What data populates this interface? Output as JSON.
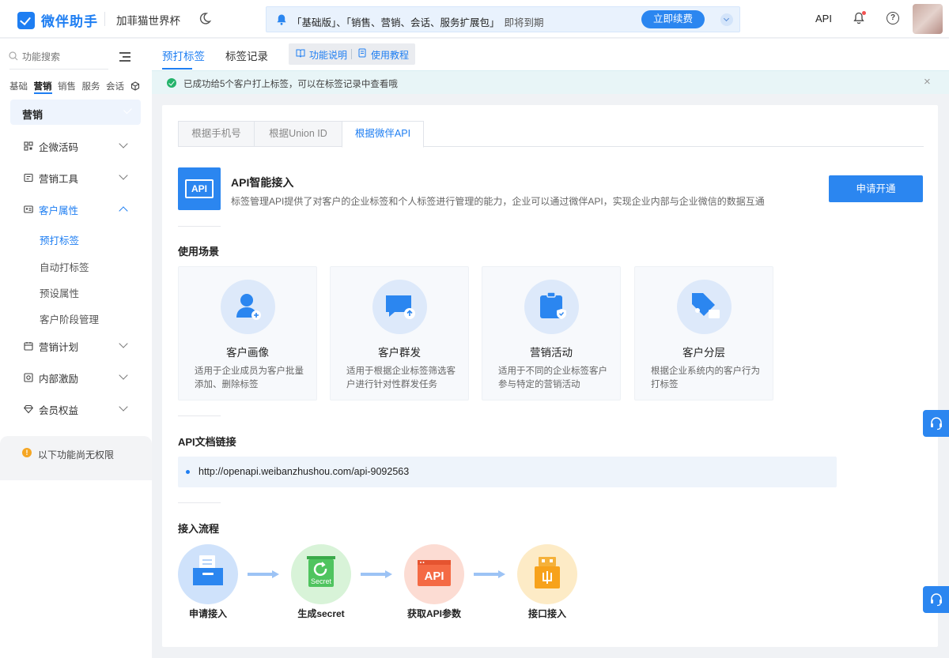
{
  "header": {
    "logo_text": "微伴助手",
    "corp_name": "加菲猫世界杯",
    "notice_text": "「基础版」、「销售、营销、会话、服务扩展包」",
    "notice_suffix": "即将到期",
    "renew_label": "立即续费",
    "api_label": "API",
    "help_glyph": "?"
  },
  "sidebar": {
    "search_placeholder": "功能搜索",
    "categories": [
      "基础",
      "营销",
      "销售",
      "服务",
      "会话"
    ],
    "active_category": "营销",
    "section_title": "营销",
    "nav": [
      {
        "label": "企微活码",
        "icon": "qrcode-icon"
      },
      {
        "label": "营销工具",
        "icon": "toolbox-icon"
      },
      {
        "label": "客户属性",
        "icon": "id-card-icon"
      },
      {
        "label": "营销计划",
        "icon": "calendar-icon"
      },
      {
        "label": "内部激励",
        "icon": "gift-icon"
      },
      {
        "label": "会员权益",
        "icon": "diamond-icon"
      }
    ],
    "sub_items": [
      "预打标签",
      "自动打标签",
      "预设属性",
      "客户阶段管理"
    ],
    "permission_glyph": "!",
    "permission_text": "以下功能尚无权限"
  },
  "page_tabs": {
    "tabs": [
      "预打标签",
      "标签记录"
    ],
    "links": [
      "功能说明",
      "使用教程"
    ]
  },
  "success": {
    "text": "已成功给5个客户打上标签，可以在标签记录中查看哦",
    "close_glyph": "×"
  },
  "main": {
    "subtabs": [
      "根据手机号",
      "根据Union ID",
      "根据微伴API"
    ],
    "api_logo_text": "API",
    "api_title": "API智能接入",
    "api_desc": "标签管理API提供了对客户的企业标签和个人标签进行管理的能力，企业可以通过微伴API，实现企业内部与企业微信的数据互通",
    "apply_label": "申请开通",
    "scenes_heading": "使用场景",
    "scenes": [
      {
        "title": "客户画像",
        "desc": "适用于企业成员为客户批量添加、删除标签"
      },
      {
        "title": "客户群发",
        "desc": "适用于根据企业标签筛选客户进行针对性群发任务"
      },
      {
        "title": "营销活动",
        "desc": "适用于不同的企业标签客户参与特定的营销活动"
      },
      {
        "title": "客户分层",
        "desc": "根据企业系统内的客户行为打标签"
      }
    ],
    "doc_heading": "API文档链接",
    "doc_url": "http://openapi.weibanzhushou.com/api-9092563",
    "flow_heading": "接入流程",
    "flow_steps": [
      "申请接入",
      "生成secret",
      "获取API参数",
      "接口接入"
    ],
    "secret_badge": "Secret",
    "api_badge": "API"
  },
  "colors": {
    "primary": "#1e7ef2",
    "success": "#24b36b",
    "warning": "#f5a623"
  }
}
